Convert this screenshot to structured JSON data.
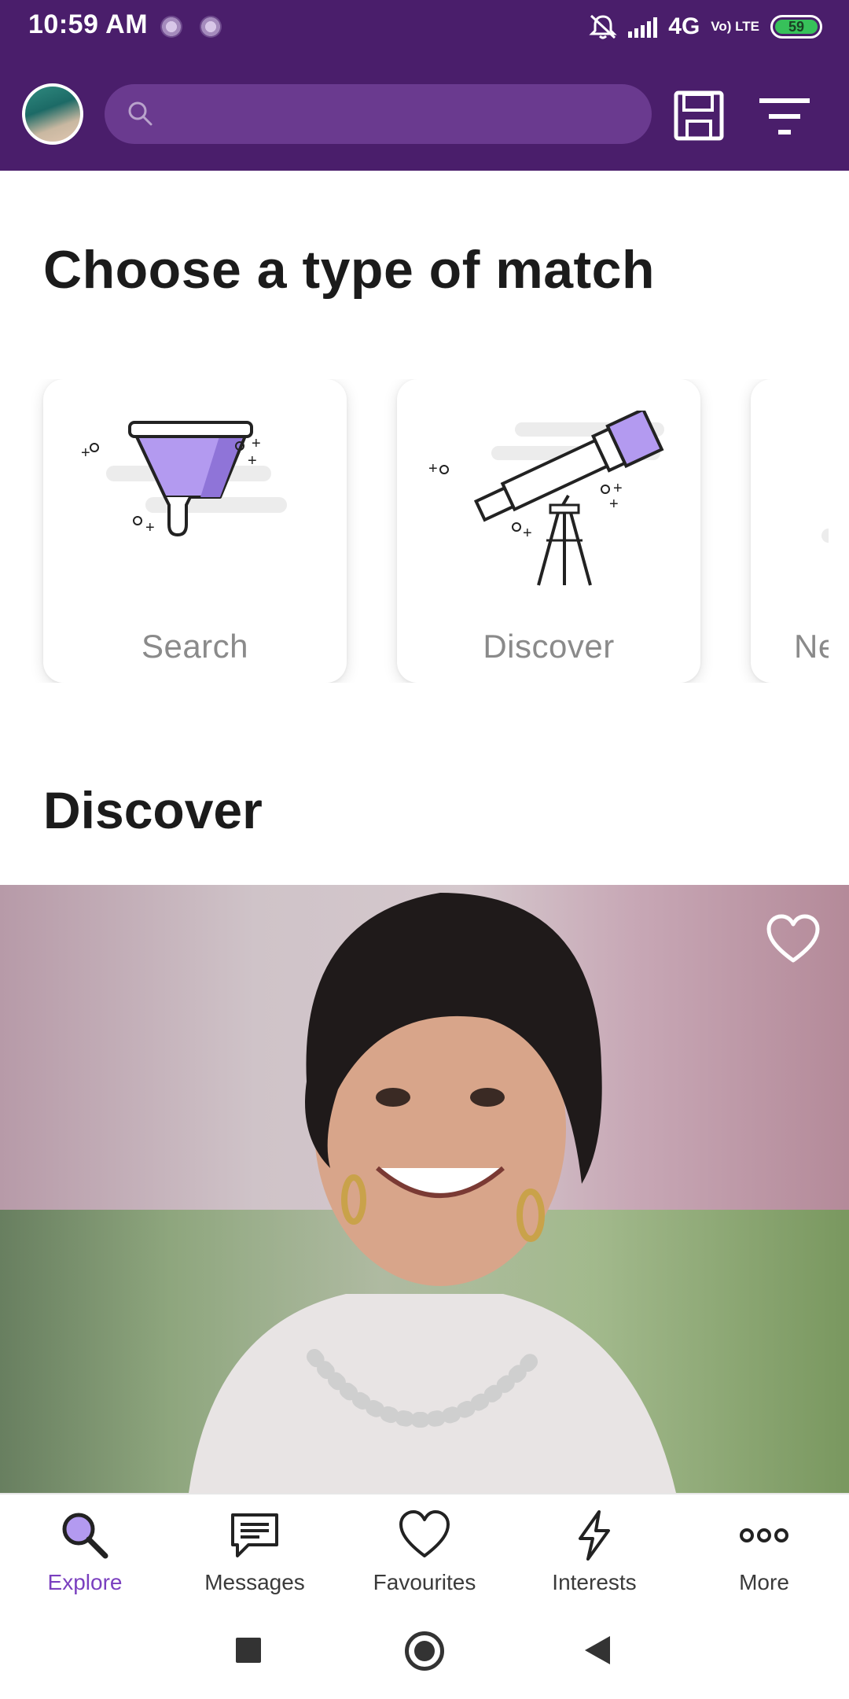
{
  "status_bar": {
    "time": "10:59 AM",
    "network": "4G",
    "volte": "Vo) LTE",
    "battery": "59",
    "icons": [
      "notification-dot-icon",
      "notification-dot-icon",
      "mute-bell-icon",
      "signal-icon",
      "battery-icon"
    ]
  },
  "header": {
    "search_placeholder": "",
    "icons": [
      "avatar",
      "search-icon",
      "save-icon",
      "filter-icon"
    ]
  },
  "match_section": {
    "title": "Choose a type of match",
    "cards": [
      {
        "label": "Search",
        "icon": "funnel-icon"
      },
      {
        "label": "Discover",
        "icon": "telescope-icon"
      },
      {
        "label": "Ne",
        "icon": "partial-card-icon"
      }
    ]
  },
  "discover_section": {
    "title": "Discover",
    "favourite_icon": "heart-icon"
  },
  "bottom_nav": {
    "items": [
      {
        "label": "Explore",
        "icon": "explore-search-icon",
        "active": true
      },
      {
        "label": "Messages",
        "icon": "message-icon",
        "active": false
      },
      {
        "label": "Favourites",
        "icon": "heart-icon",
        "active": false
      },
      {
        "label": "Interests",
        "icon": "lightning-icon",
        "active": false
      },
      {
        "label": "More",
        "icon": "more-dots-icon",
        "active": false
      }
    ]
  },
  "colors": {
    "header_bg": "#4a1e6b",
    "search_bg": "#6a3a8f",
    "accent": "#7a3fbf",
    "illustration_purple": "#b39af0"
  }
}
